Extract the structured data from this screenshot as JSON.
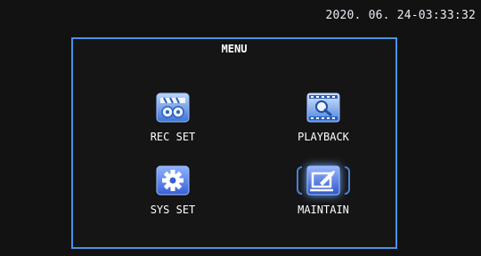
{
  "datetime": "2020. 06. 24-03:33:32",
  "menu": {
    "title": "MENU",
    "selected_item": "MAINTAIN",
    "items": [
      {
        "label": "REC SET",
        "icon": "film-reel-icon"
      },
      {
        "label": "PLAYBACK",
        "icon": "magnifier-film-icon"
      },
      {
        "label": "SYS SET",
        "icon": "gear-icon"
      },
      {
        "label": "MAINTAIN",
        "icon": "wrench-monitor-icon"
      }
    ]
  },
  "colors": {
    "background": "#121212",
    "panel_border": "#4a92e6",
    "icon_blue": "#2f67c8",
    "icon_light": "#8fb8f0",
    "text": "#ffffff"
  }
}
